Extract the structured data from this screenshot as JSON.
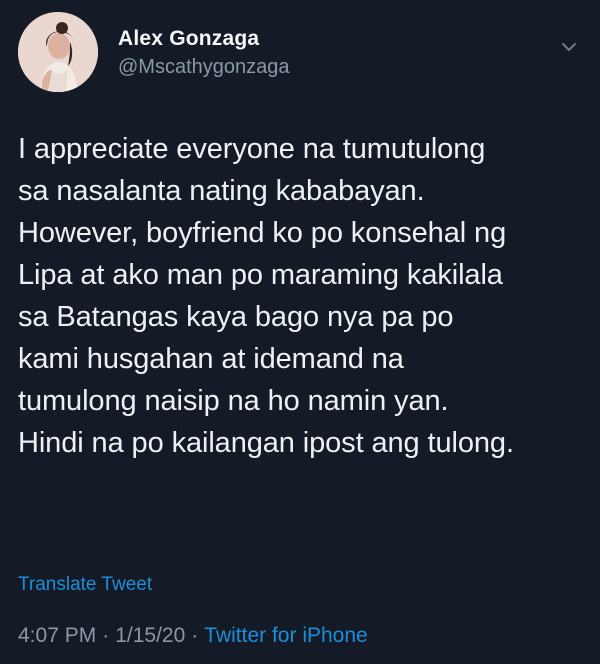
{
  "tweet": {
    "author": {
      "display_name": "Alex Gonzaga",
      "handle": "@Mscathygonzaga",
      "avatar_icon": "profile-avatar"
    },
    "menu_icon": "chevron-down-icon",
    "text_lines": [
      "I appreciate everyone na tumutulong",
      "sa nasalanta nating kababayan.",
      "However, boyfriend ko po konsehal ng",
      "Lipa at ako man po maraming kakilala",
      "sa Batangas kaya bago nya pa po",
      "kami husgahan at idemand na",
      "tumulong naisip na ho namin yan.",
      "Hindi na po kailangan ipost ang tulong."
    ],
    "translate_label": "Translate Tweet",
    "time": "4:07 PM",
    "date": "1/15/20",
    "separator": "·",
    "source": "Twitter for iPhone"
  },
  "colors": {
    "background": "#141b26",
    "link": "#1b8fd9",
    "secondary_text": "#8b98a5",
    "primary_text": "#eef1f4"
  }
}
